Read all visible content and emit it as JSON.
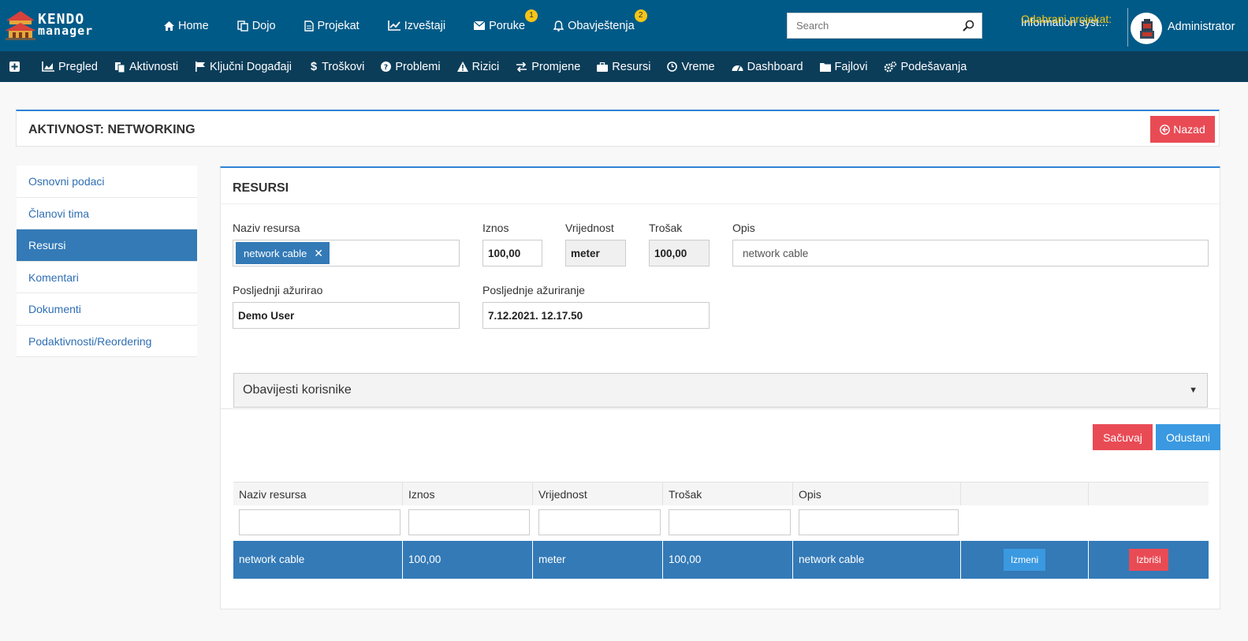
{
  "brand": {
    "logo_line1": "KENDO",
    "logo_line2": "manager"
  },
  "topnav": {
    "items": [
      {
        "label": "Home",
        "icon": "home-icon"
      },
      {
        "label": "Dojo",
        "icon": "copy-icon"
      },
      {
        "label": "Projekat",
        "icon": "file-icon"
      },
      {
        "label": "Izveštaji",
        "icon": "line-chart-icon"
      },
      {
        "label": "Poruke",
        "icon": "envelope-icon",
        "badge": "1"
      },
      {
        "label": "Obavještenja",
        "icon": "bell-icon",
        "badge": "2"
      }
    ]
  },
  "search": {
    "placeholder": "Search"
  },
  "project": {
    "label": "Odabrani projekat:",
    "value": "Information syst..."
  },
  "user": {
    "name": "Administrator"
  },
  "subnav": {
    "items": [
      {
        "label": "Pregled",
        "icon": "area-chart-icon"
      },
      {
        "label": "Aktivnosti",
        "icon": "files-icon"
      },
      {
        "label": "Ključni Događaji",
        "icon": "flag-icon"
      },
      {
        "label": "Troškovi",
        "icon": "dollar-icon"
      },
      {
        "label": "Problemi",
        "icon": "question-circle-icon"
      },
      {
        "label": "Rizici",
        "icon": "warning-icon"
      },
      {
        "label": "Promjene",
        "icon": "exchange-icon"
      },
      {
        "label": "Resursi",
        "icon": "briefcase-icon"
      },
      {
        "label": "Vreme",
        "icon": "clock-icon"
      },
      {
        "label": "Dashboard",
        "icon": "dashboard-icon"
      },
      {
        "label": "Fajlovi",
        "icon": "folder-icon"
      },
      {
        "label": "Podešavanja",
        "icon": "cogs-icon"
      }
    ]
  },
  "page": {
    "title": "AKTIVNOST: NETWORKING",
    "back_label": "Nazad"
  },
  "sidebar": {
    "items": [
      {
        "label": "Osnovni podaci"
      },
      {
        "label": "Članovi tima"
      },
      {
        "label": "Resursi"
      },
      {
        "label": "Komentari"
      },
      {
        "label": "Dokumenti"
      },
      {
        "label": "Podaktivnosti/Reordering"
      }
    ],
    "active_index": 2
  },
  "form": {
    "title": "RESURSI",
    "naziv_label": "Naziv resursa",
    "naziv_tag": "network cable",
    "iznos_label": "Iznos",
    "iznos_value": "100,00",
    "vrijednost_label": "Vrijednost",
    "vrijednost_value": "meter",
    "trosak_label": "Trošak",
    "trosak_value": "100,00",
    "opis_label": "Opis",
    "opis_value": "network cable",
    "updated_by_label": "Posljednji ažurirao",
    "updated_by_value": "Demo User",
    "updated_at_label": "Posljednje ažuriranje",
    "updated_at_value": "7.12.2021. 12.17.50",
    "notify_label": "Obavijesti korisnike",
    "save_label": "Sačuvaj",
    "cancel_label": "Odustani"
  },
  "grid": {
    "columns": [
      "Naziv resursa",
      "Iznos",
      "Vrijednost",
      "Trošak",
      "Opis",
      "",
      ""
    ],
    "rows": [
      {
        "naziv": "network cable",
        "iznos": "100,00",
        "vrijednost": "meter",
        "trosak": "100,00",
        "opis": "network cable",
        "edit_label": "Izmeni",
        "delete_label": "Izbriši"
      }
    ]
  },
  "colors": {
    "topbar": "#005a87",
    "subnav": "#0b3d59",
    "primary": "#337ab7",
    "danger": "#e94b55",
    "accent_yellow": "#f5c518"
  }
}
